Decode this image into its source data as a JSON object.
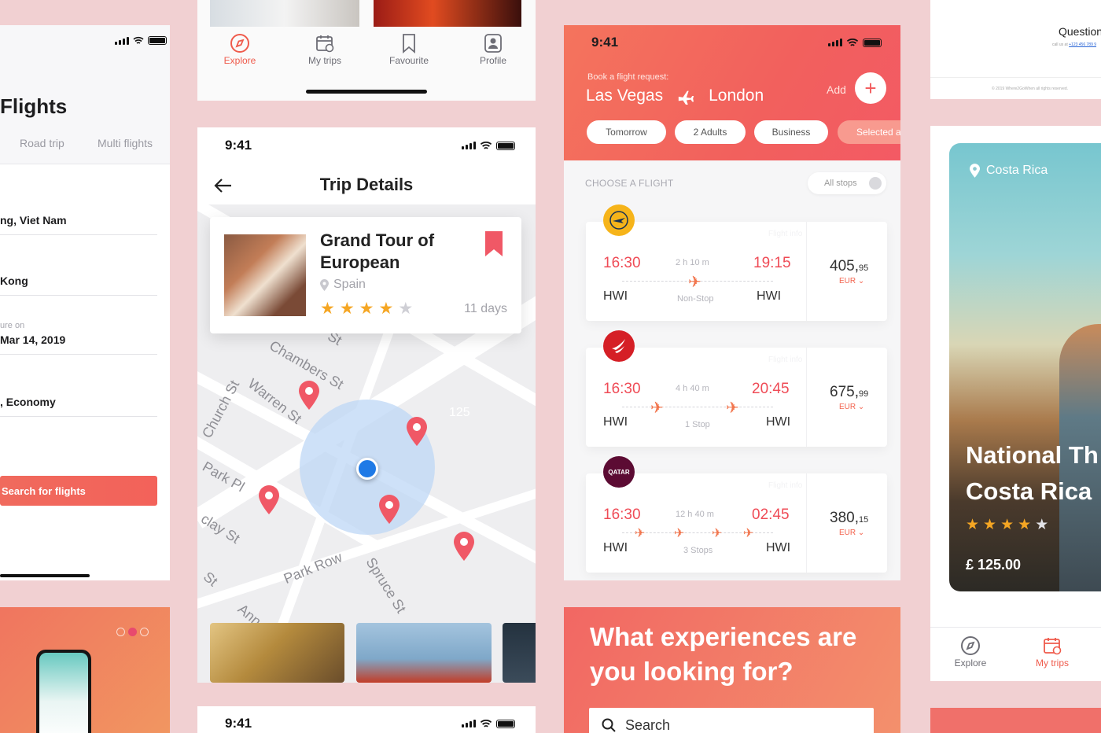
{
  "status": {
    "time": "9:41"
  },
  "flights_form": {
    "title": "Flights",
    "tabs": [
      "Road trip",
      "Multi flights"
    ],
    "fields": [
      {
        "label": "",
        "value": "ng, Viet Nam"
      },
      {
        "label": "",
        "value": "Kong"
      },
      {
        "label": "ure on",
        "value": "Mar 14, 2019"
      },
      {
        "label": "",
        "value": ", Economy"
      }
    ],
    "search_button": "Search for flights"
  },
  "tabbar": {
    "items": [
      {
        "label": "Explore",
        "icon": "compass-icon",
        "active": true
      },
      {
        "label": "My trips",
        "icon": "calendar-icon",
        "active": false
      },
      {
        "label": "Favourite",
        "icon": "bookmark-icon",
        "active": false
      },
      {
        "label": "Profile",
        "icon": "profile-icon",
        "active": false
      }
    ]
  },
  "trip_details": {
    "nav_title": "Trip Details",
    "trip": {
      "name": "Grand Tour of European",
      "location": "Spain",
      "rating": 4,
      "max_rating": 5,
      "duration": "11 days"
    },
    "streets": [
      "Chambers St",
      "Warren St",
      "Church St",
      "Park Pl",
      "clay St",
      "Park Row",
      "Spruce St",
      "Ann",
      "St",
      "St"
    ],
    "map_label": "125"
  },
  "flight_list": {
    "request_label": "Book a flight request:",
    "from": "Las Vegas",
    "to": "London",
    "add_label": "Add",
    "chips": [
      "Tomorrow",
      "2 Adults",
      "Business",
      "Selected ai"
    ],
    "section_title": "CHOOSE A FLIGHT",
    "filter": "All stops",
    "flight_info_label": "Flight info",
    "flights": [
      {
        "airline": "Lufthansa",
        "depart": "16:30",
        "arrive": "19:15",
        "from": "HWI",
        "to": "HWI",
        "duration": "2 h 10 m",
        "stops": "Non-Stop",
        "price_main": "405,",
        "price_cents": "95",
        "currency": "EUR",
        "logo_color": "#f6b41a"
      },
      {
        "airline": "Turkish Airlines",
        "depart": "16:30",
        "arrive": "20:45",
        "from": "HWI",
        "to": "HWI",
        "duration": "4 h 40 m",
        "stops": "1 Stop",
        "price_main": "675,",
        "price_cents": "99",
        "currency": "EUR",
        "logo_color": "#d51f26"
      },
      {
        "airline": "QATAR",
        "depart": "16:30",
        "arrive": "02:45",
        "from": "HWI",
        "to": "HWI",
        "duration": "12 h 40 m",
        "stops": "3 Stops",
        "price_main": "380,",
        "price_cents": "15",
        "currency": "EUR",
        "logo_color": "#5c0b33"
      }
    ]
  },
  "experiences": {
    "heading": "What experiences are you looking for?",
    "search_placeholder": "Search"
  },
  "questions_card": {
    "title": "Question",
    "subtitle": "call us at",
    "phone": "+123 456 789 9",
    "copyright": "© 2019 Where2GoWhen all rights reserved."
  },
  "costa_rica": {
    "location": "Costa Rica",
    "title_line1": "National Th",
    "title_line2": "Costa Rica",
    "rating": 4,
    "max_rating": 5,
    "price": "£ 125.00",
    "tabs": [
      {
        "label": "Explore",
        "active": false
      },
      {
        "label": "My trips",
        "active": true
      }
    ]
  },
  "colors": {
    "accent": "#ef5b4c",
    "star": "#f5a623",
    "map_blue": "#1f7ae6"
  }
}
